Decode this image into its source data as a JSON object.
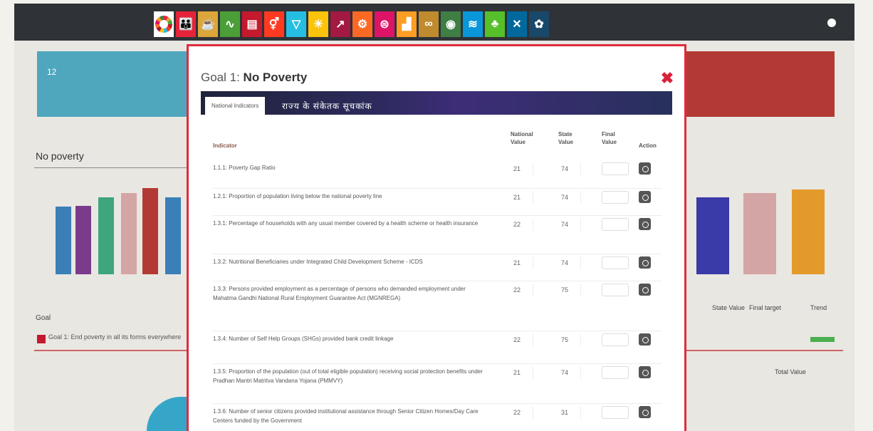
{
  "nav": {
    "goals": [
      {
        "icon": "sdg-wheel-icon",
        "color": "#ffffff",
        "glyph": ""
      },
      {
        "icon": "no-poverty-icon",
        "color": "#e5243b",
        "glyph": "👪"
      },
      {
        "icon": "zero-hunger-icon",
        "color": "#dda63a",
        "glyph": "☕"
      },
      {
        "icon": "good-health-icon",
        "color": "#4c9f38",
        "glyph": "∿"
      },
      {
        "icon": "quality-education-icon",
        "color": "#c5192d",
        "glyph": "▤"
      },
      {
        "icon": "gender-equality-icon",
        "color": "#ff3a21",
        "glyph": "⚥"
      },
      {
        "icon": "clean-water-icon",
        "color": "#26bde2",
        "glyph": "▽"
      },
      {
        "icon": "clean-energy-icon",
        "color": "#fcc30b",
        "glyph": "☀"
      },
      {
        "icon": "decent-work-icon",
        "color": "#a21942",
        "glyph": "↗"
      },
      {
        "icon": "industry-icon",
        "color": "#fd6925",
        "glyph": "⚙"
      },
      {
        "icon": "reduced-inequalities-icon",
        "color": "#dd1367",
        "glyph": "⊜"
      },
      {
        "icon": "sustainable-cities-icon",
        "color": "#fd9d24",
        "glyph": "▟"
      },
      {
        "icon": "responsible-consumption-icon",
        "color": "#bf8b2e",
        "glyph": "∞"
      },
      {
        "icon": "climate-action-icon",
        "color": "#3f7e44",
        "glyph": "◉"
      },
      {
        "icon": "life-below-water-icon",
        "color": "#0a97d9",
        "glyph": "≋"
      },
      {
        "icon": "life-on-land-icon",
        "color": "#56c02b",
        "glyph": "♣"
      },
      {
        "icon": "peace-justice-icon",
        "color": "#00689d",
        "glyph": "✕"
      },
      {
        "icon": "partnerships-icon",
        "color": "#19486a",
        "glyph": "✿"
      }
    ]
  },
  "background": {
    "card_value": "12",
    "section_title": "No poverty",
    "goal_header": "Goal",
    "goal_row": "Goal 1: End poverty in all its forms everywhere",
    "state_value": "State Value",
    "final_target": "Final target",
    "trend": "Trend",
    "total_value": "Total Value",
    "bars": [
      {
        "color": "#3a7fb8",
        "value": 72
      },
      {
        "color": "#7a3b8c",
        "value": 73
      },
      {
        "color": "#3ea57c",
        "value": 82
      },
      {
        "color": "#d4a5a5",
        "value": 86
      },
      {
        "color": "#b33a34",
        "value": 92
      },
      {
        "color": "#3a7fb8",
        "value": 82
      },
      {
        "color": "#3a3aa8",
        "value": 82
      },
      {
        "color": "#d4a5a5",
        "value": 86
      },
      {
        "color": "#e39a2b",
        "value": 90
      }
    ]
  },
  "modal": {
    "title_prefix": "Goal 1:",
    "title_name": "No Poverty",
    "tabs": {
      "active": "National Indicators",
      "other": "राज्य के संकेतक सूचकांक"
    },
    "table": {
      "headers": {
        "indicator": "Indicator",
        "national": "National Value",
        "state": "State Value",
        "final": "Final Value",
        "action": "Action"
      },
      "rows": [
        {
          "indicator": "1.1.1: Poverty Gap Ratio",
          "national": "21",
          "state": "74"
        },
        {
          "indicator": "1.2.1: Proportion of population living below the national poverty line",
          "national": "21",
          "state": "74"
        },
        {
          "indicator": "1.3.1: Percentage of households with any usual member covered by a health scheme or health insurance",
          "national": "22",
          "state": "74"
        },
        {
          "indicator": "1.3.2: Nutritional Beneficiaries under Integrated Child Development Scheme - ICDS",
          "national": "21",
          "state": "74"
        },
        {
          "indicator": "1.3.3: Persons provided employment as a percentage of persons who demanded employment under Mahatma Gandhi National Rural Employment Guarantee Act (MGNREGA)",
          "national": "22",
          "state": "75"
        },
        {
          "indicator": "1.3.4: Number of Self Help Groups (SHGs) provided bank credit linkage",
          "national": "22",
          "state": "75"
        },
        {
          "indicator": "1.3.5: Proportion of the population (out of total eligible population) receiving social protection benefits under Pradhan Mantri Matritva Vandana Yojana (PMMVY)",
          "national": "21",
          "state": "74"
        },
        {
          "indicator": "1.3.6: Number of senior citizens provided institutional assistance through Senior Citizen Homes/Day Care Centers funded by the Government",
          "national": "22",
          "state": "31"
        }
      ]
    }
  }
}
